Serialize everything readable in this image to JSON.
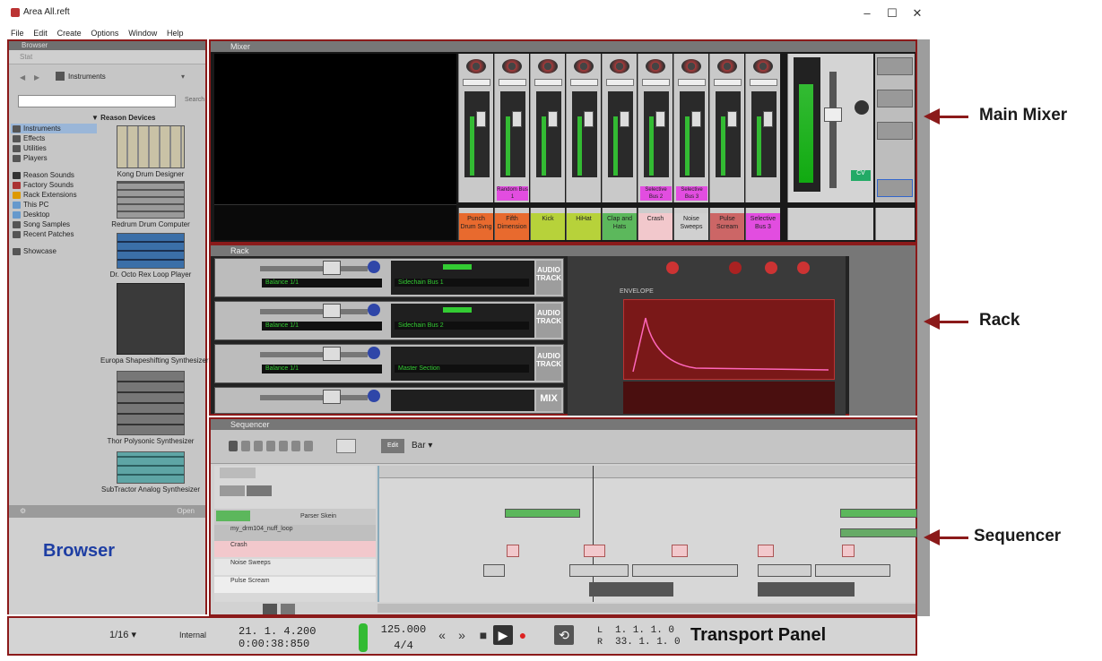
{
  "window": {
    "title": "Area All.reft",
    "min": "–",
    "max": "☐",
    "close": "✕"
  },
  "menu": [
    "File",
    "Edit",
    "Create",
    "Options",
    "Window",
    "Help"
  ],
  "browser": {
    "header": "Browser",
    "tab": "Stat",
    "location": "Instruments",
    "search_label": "Search",
    "section_header": "Reason Devices",
    "side_items": [
      "Instruments",
      "Effects",
      "Utilities",
      "Players"
    ],
    "side_items2": [
      "Reason Sounds",
      "Factory Sounds",
      "Rack Extensions",
      "This PC",
      "Desktop",
      "Song Samples",
      "Recent Patches"
    ],
    "side_items3": [
      "Showcase"
    ],
    "devices": [
      "Kong Drum Designer",
      "Redrum Drum Computer",
      "Dr. Octo Rex Loop Player",
      "Europa Shapeshifting Synthesizer",
      "Thor Polysonic Synthesizer",
      "SubTractor Analog Synthesizer"
    ],
    "footer_open": "Open",
    "annotation": "Browser"
  },
  "mixer": {
    "title": "Mixer",
    "annotation": "Main Mixer",
    "channels": [
      {
        "label": "Punch Drum Svng",
        "color": "#e86a2e",
        "pink": ""
      },
      {
        "label": "Fifth Dimension",
        "color": "#e86a2e",
        "pink": "Random Bus 1"
      },
      {
        "label": "Kick",
        "color": "#b7d23a",
        "pink": ""
      },
      {
        "label": "HiHat",
        "color": "#b7d23a",
        "pink": ""
      },
      {
        "label": "Clap and Hats",
        "color": "#5cb85c",
        "pink": ""
      },
      {
        "label": "Crash",
        "color": "#f2c8cc",
        "pink": "Selective Bus 2"
      },
      {
        "label": "Noise Sweeps",
        "color": "#d0d0d0",
        "pink": "Selective Bus 3"
      },
      {
        "label": "Pulse Scream",
        "color": "#c66",
        "pink": ""
      },
      {
        "label": "Selective Bus 3",
        "color": "#e24de0",
        "pink": ""
      }
    ],
    "master_cv": "CV"
  },
  "rack": {
    "title": "Rack",
    "annotation": "Rack",
    "rows": [
      {
        "lcd": "Balance 1/1",
        "out": "Sidechain Bus 1",
        "side": "AUDIO TRACK"
      },
      {
        "lcd": "Balance 1/1",
        "out": "Sidechain Bus 2",
        "side": "AUDIO TRACK"
      },
      {
        "lcd": "Balance 1/1",
        "out": "Master Section",
        "side": "AUDIO TRACK"
      },
      {
        "lcd": "",
        "out": "",
        "side": "MIX"
      }
    ],
    "env_label": "ENVELOPE"
  },
  "sequencer": {
    "title": "Sequencer",
    "annotation": "Sequencer",
    "snap": "Bar",
    "mode": "Edit",
    "tracks": [
      "Parser Skein",
      "my_drm104_nuff_loop",
      "Crash",
      "Noise Sweeps",
      "Pulse Scream"
    ]
  },
  "transport": {
    "annotation": "Transport Panel",
    "quantize": "1/16",
    "sync": "Internal",
    "pos_top": "21. 1. 4.200",
    "pos_bottom": "0:00:38:850",
    "tempo": "125.000",
    "signature": "4/4",
    "loop_left": "1. 1. 1.",
    "loop_right": "33. 1. 1.",
    "l_label": "L",
    "r_label": "R",
    "loop_l_trail": "0",
    "loop_r_trail": "0"
  }
}
